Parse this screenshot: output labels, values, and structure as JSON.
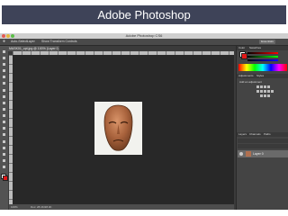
{
  "slide": {
    "title": "Adobe Photoshop"
  },
  "app": {
    "window_title": "Adobe Photoshop CS6",
    "options_bar": {
      "auto_select_label": "Auto-Select:",
      "auto_select_value": "Layer",
      "transform_label": "Show Transform Controls",
      "workspace": "Essentials"
    },
    "document_tab": "MASK01_opt.jpg @ 100% (Layer 0, RGB/8#)",
    "status": {
      "zoom": "100%",
      "doc_info": "Doc: 28.4K/28.4K"
    },
    "panels": {
      "color_tabs": [
        "Color",
        "Swatches"
      ],
      "adjust_tabs": [
        "Adjustments",
        "Styles"
      ],
      "adjust_label": "Add an adjustment",
      "layers_tabs": [
        "Layers",
        "Channels",
        "Paths"
      ],
      "layer_name": "Layer 0"
    },
    "tools": [
      "move-tool",
      "marquee-tool",
      "lasso-tool",
      "quick-select-tool",
      "crop-tool",
      "eyedropper-tool",
      "healing-tool",
      "brush-tool",
      "clone-stamp-tool",
      "history-brush-tool",
      "eraser-tool",
      "gradient-tool",
      "blur-tool",
      "dodge-tool",
      "pen-tool",
      "type-tool",
      "path-select-tool",
      "shape-tool",
      "hand-tool",
      "zoom-tool"
    ],
    "colors": {
      "foreground": "#ffffff",
      "background": "#e01818"
    }
  }
}
